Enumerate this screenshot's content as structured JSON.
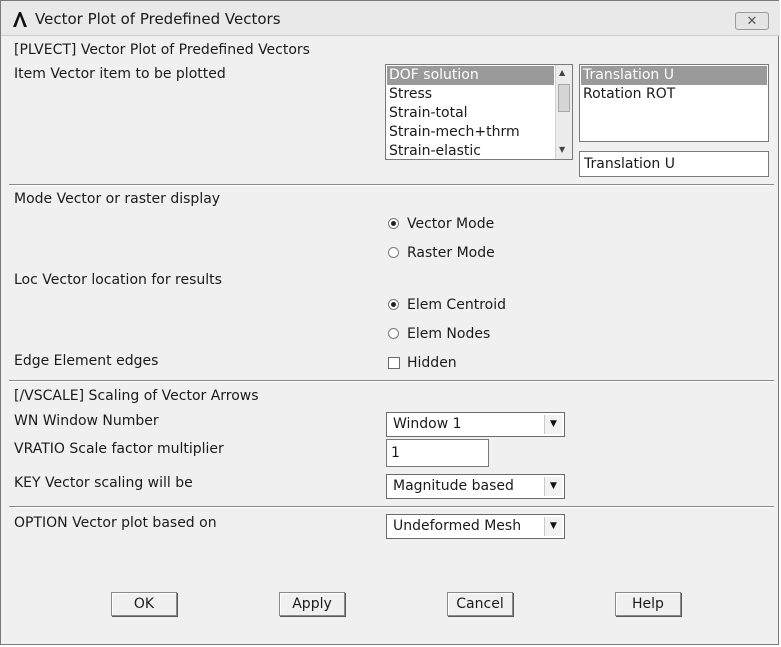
{
  "window": {
    "title": "Vector Plot of Predefined Vectors",
    "close_icon": "close-icon"
  },
  "plvect": {
    "header": "[PLVECT]  Vector Plot of Predefined Vectors",
    "item_label": "Item  Vector item to be plotted",
    "item_list": [
      "DOF solution",
      "Stress",
      "Strain-total",
      "Strain-mech+thrm",
      "Strain-elastic"
    ],
    "item_selected": "DOF solution",
    "comp_list": [
      "Translation    U",
      "Rotation    ROT"
    ],
    "comp_selected": "Translation    U",
    "comp_value": "Translation    U",
    "mode_label": "Mode  Vector or raster display",
    "mode_options": [
      "Vector Mode",
      "Raster Mode"
    ],
    "mode_selected": "Vector Mode",
    "loc_label": "Loc  Vector location for results",
    "loc_options": [
      "Elem Centroid",
      "Elem Nodes"
    ],
    "loc_selected": "Elem Centroid",
    "edge_label": "Edge Element edges",
    "edge_check_label": "Hidden",
    "edge_checked": false
  },
  "vscale": {
    "header": "[/VSCALE] Scaling of Vector Arrows",
    "wn_label": "WN  Window Number",
    "wn_value": "Window 1",
    "vratio_label": "VRATIO  Scale factor multiplier",
    "vratio_value": "1",
    "key_label": "KEY     Vector scaling will be",
    "key_value": "Magnitude based"
  },
  "option": {
    "label": "OPTION  Vector plot based on",
    "value": "Undeformed Mesh"
  },
  "buttons": {
    "ok": "OK",
    "apply": "Apply",
    "cancel": "Cancel",
    "help": "Help"
  }
}
